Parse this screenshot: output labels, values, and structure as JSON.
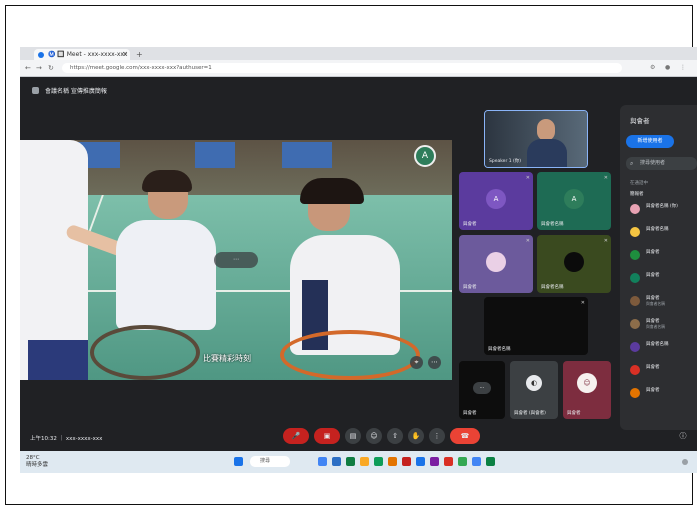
{
  "browser": {
    "tab_title": "Ⓜ️ 🔲 Meet - xxx-xxxx-xxx",
    "tab_close": "×",
    "new_tab": "+",
    "url": "https://meet.google.com/xxx-xxxx-xxx?authuser=1"
  },
  "meeting": {
    "title": "會議名稱 宣傳推廣簡報",
    "main_caption": "比賽精彩時刻",
    "overlay_pill": "⋯",
    "main_avatar_letter": "A",
    "bottom_label": "上午10:32 ｜ xxx-xxxx-xxx",
    "tiles": [
      {
        "name": "Speaker 1 (你)",
        "letter": "",
        "color": "#3d4a5a"
      },
      {
        "name": "與會者",
        "letter": "A",
        "color": "#5b3b9e"
      },
      {
        "name": "與會者名稱",
        "letter": "A",
        "color": "#1e6b54"
      },
      {
        "name": "與會者",
        "letter": "",
        "color": "#6c5a9c"
      },
      {
        "name": "與會者名稱",
        "letter": "",
        "color": "#3a4a1f"
      },
      {
        "name": "與會者名稱",
        "letter": "",
        "color": "#0d0d0d"
      },
      {
        "name": "與會者",
        "letter": "",
        "color": "#0d0d0d"
      },
      {
        "name": "與會者 (與會者)",
        "letter": "",
        "color": "#3c4043"
      },
      {
        "name": "與會者",
        "letter": "",
        "color": "#7d2d3f"
      }
    ]
  },
  "panel": {
    "title": "與會者",
    "add_button": "新增使用者",
    "search_placeholder": "搜尋使用者",
    "section_label": "在通話中",
    "sub_label": "簡報者",
    "people": [
      {
        "name": "與會者名稱 (你)",
        "sub": "",
        "color": "#e8a2b3"
      },
      {
        "name": "與會者名稱",
        "sub": "",
        "color": "#f5c542"
      },
      {
        "name": "與會者",
        "sub": "",
        "color": "#1e8e3e"
      },
      {
        "name": "與會者",
        "sub": "",
        "color": "#12805c"
      },
      {
        "name": "與會者",
        "sub": "與會者名稱",
        "color": "#7d5a3c"
      },
      {
        "name": "與會者",
        "sub": "與會者名稱",
        "color": "#8c6d4a"
      },
      {
        "name": "與會者名稱",
        "sub": "",
        "color": "#5b3b9e"
      },
      {
        "name": "與會者",
        "sub": "",
        "color": "#d93025"
      },
      {
        "name": "與會者",
        "sub": "",
        "color": "#e37400"
      }
    ]
  },
  "taskbar": {
    "weather_temp": "28°C",
    "weather_desc": "晴時多雲",
    "search": "搜尋"
  }
}
